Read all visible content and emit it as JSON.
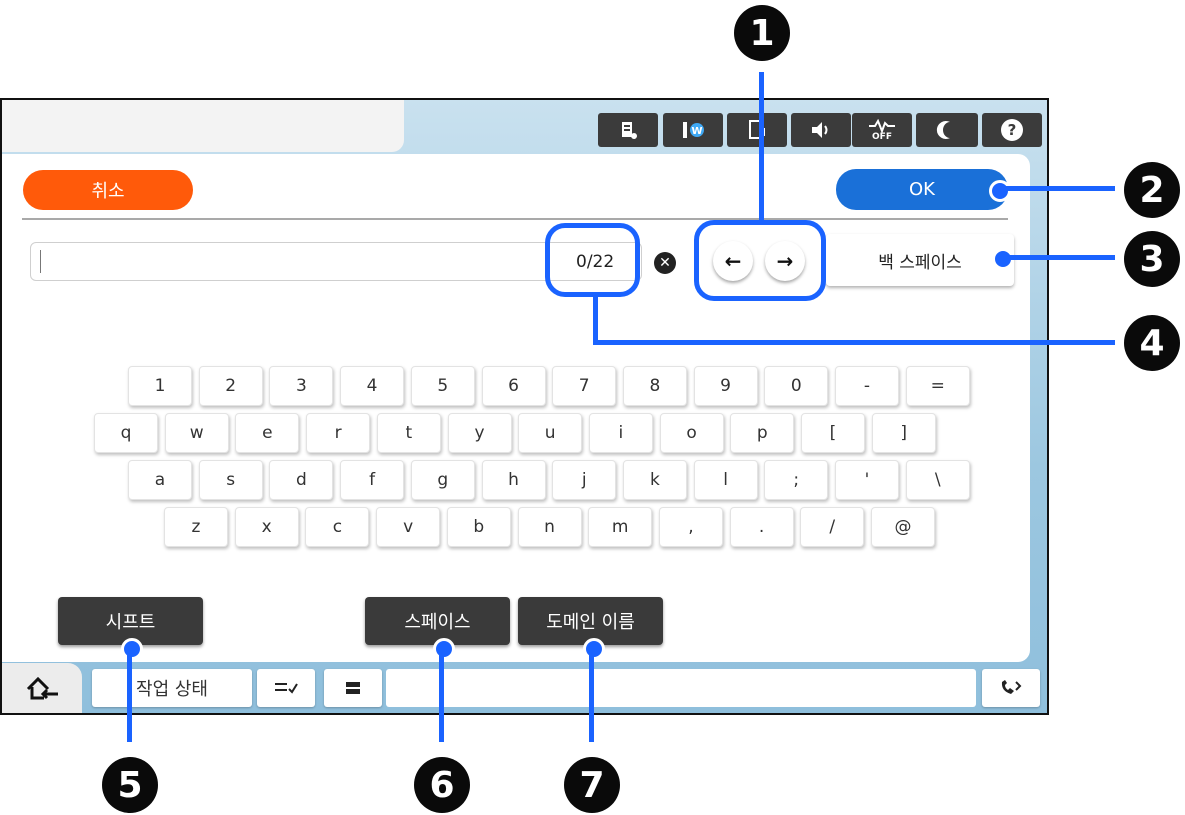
{
  "status_icons": [
    {
      "name": "ink-icon",
      "label": "▮"
    },
    {
      "name": "wifi-direct-icon",
      "label": "●"
    },
    {
      "name": "phone-icon",
      "label": "▯"
    },
    {
      "name": "volume-icon",
      "label": "◀)"
    },
    {
      "name": "fax-off-icon",
      "label": "OFF"
    },
    {
      "name": "sleep-moon-icon",
      "label": "☾"
    },
    {
      "name": "help-icon",
      "label": "?"
    }
  ],
  "header": {
    "cancel_label": "취소",
    "ok_label": "OK"
  },
  "input": {
    "value": "",
    "char_count": "0/22"
  },
  "nav": {
    "left_arrow": "←",
    "right_arrow": "→",
    "backspace_label": "백 스페이스"
  },
  "keyboard": {
    "row1": [
      "1",
      "2",
      "3",
      "4",
      "5",
      "6",
      "7",
      "8",
      "9",
      "0",
      "-",
      "="
    ],
    "row2": [
      "q",
      "w",
      "e",
      "r",
      "t",
      "y",
      "u",
      "i",
      "o",
      "p",
      "[",
      "]"
    ],
    "row3": [
      "a",
      "s",
      "d",
      "f",
      "g",
      "h",
      "j",
      "k",
      "l",
      ";",
      "'",
      "\\"
    ],
    "row4": [
      "z",
      "x",
      "c",
      "v",
      "b",
      "n",
      "m",
      ",",
      ".",
      "/",
      "@"
    ]
  },
  "actions": {
    "shift_label": "시프트",
    "space_label": "스페이스",
    "domain_label": "도메인 이름"
  },
  "bottombar": {
    "job_status_label": "작업 상태"
  },
  "callouts": [
    "1",
    "2",
    "3",
    "4",
    "5",
    "6",
    "7"
  ],
  "colors": {
    "cancel": "#ff5500",
    "ok": "#1a6fd6",
    "callout": "#1a63ff"
  }
}
